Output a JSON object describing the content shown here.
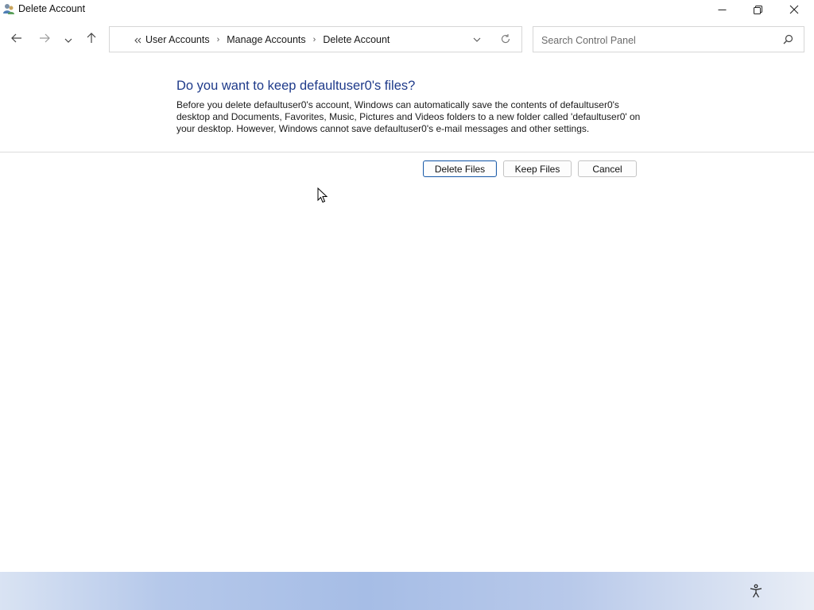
{
  "window": {
    "title": "Delete Account",
    "controls": {
      "minimize": "minimize",
      "maximize": "restore",
      "close": "close"
    }
  },
  "navigation": {
    "breadcrumbs": [
      "User Accounts",
      "Manage Accounts",
      "Delete Account"
    ],
    "search": {
      "placeholder": "Search Control Panel",
      "value": ""
    }
  },
  "content": {
    "heading": "Do you want to keep defaultuser0's files?",
    "description": "Before you delete defaultuser0's account, Windows can automatically save the contents of defaultuser0's desktop and Documents, Favorites, Music, Pictures and Videos folders to a new folder called 'defaultuser0' on your desktop. However, Windows cannot save defaultuser0's e-mail messages and other settings.",
    "buttons": {
      "delete_files": "Delete Files",
      "keep_files": "Keep Files",
      "cancel": "Cancel"
    }
  },
  "colors": {
    "heading": "#1e3a8a",
    "primary_border": "#1f5ea8"
  },
  "icons": [
    "user-accounts-icon",
    "minimize-icon",
    "restore-icon",
    "close-icon",
    "back-arrow-icon",
    "forward-arrow-icon",
    "recent-locations-chevron-icon",
    "up-arrow-icon",
    "breadcrumb-chevron-icon",
    "address-dropdown-icon",
    "refresh-icon",
    "search-icon",
    "mouse-cursor-icon",
    "accessibility-icon"
  ]
}
